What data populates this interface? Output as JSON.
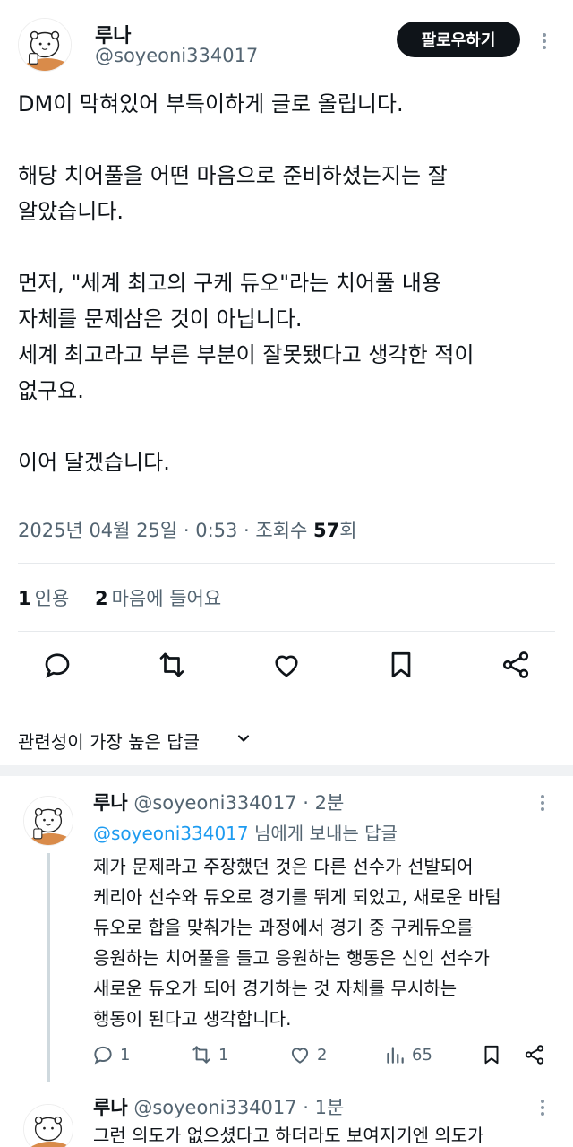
{
  "tweet": {
    "author_name": "루나",
    "author_handle": "@soyeoni334017",
    "follow_label": "팔로우하기",
    "lines": [
      "DM이 막혀있어 부득이하게 글로 올립니다.",
      "",
      "해당 치어풀을 어떤 마음으로 준비하셨는지는 잘",
      "알았습니다.",
      "",
      "먼저, \"세계 최고의 구케 듀오\"라는 치어풀 내용",
      "자체를 문제삼은 것이 아닙니다.",
      "세계 최고라고 부른 부분이 잘못됐다고 생각한 적이",
      "없구요.",
      "",
      "이어 달겠습니다."
    ],
    "meta_prefix": "2025년 04월 25일 · 0:53 · 조회수 ",
    "views": "57",
    "views_suffix": "회",
    "quote_count": "1",
    "quote_label": "인용",
    "like_count": "2",
    "like_label": "마음에 들어요"
  },
  "sort": {
    "label": "관련성이 가장 높은 답글"
  },
  "replies": [
    {
      "author_name": "루나",
      "author_handle": "@soyeoni334017",
      "time": " · 2분",
      "reply_to_mention": "@soyeoni334017",
      "reply_to_suffix": " 님에게 보내는 답글",
      "lines": [
        "제가 문제라고 주장했던 것은 다른 선수가 선발되어",
        "케리아 선수와 듀오로 경기를 뛰게 되었고, 새로운 바텀",
        "듀오로 합을 맞춰가는 과정에서 경기 중 구케듀오를",
        "응원하는 치어풀을 들고 응원하는 행동은 신인 선수가",
        "새로운 듀오가 되어 경기하는 것 자체를 무시하는",
        "행동이 된다고 생각합니다."
      ],
      "reply_count": "1",
      "retweet_count": "1",
      "like_count": "2",
      "view_count": "65"
    },
    {
      "author_name": "루나",
      "author_handle": "@soyeoni334017",
      "time": " · 1분",
      "lines": [
        "그런 의도가 없으셨다고 하더라도 보여지기엔 의도가"
      ]
    }
  ],
  "colors": {
    "accent": "#1d9bf0",
    "text": "#0f1419",
    "muted": "#536471",
    "button_bg": "#0f1419"
  }
}
